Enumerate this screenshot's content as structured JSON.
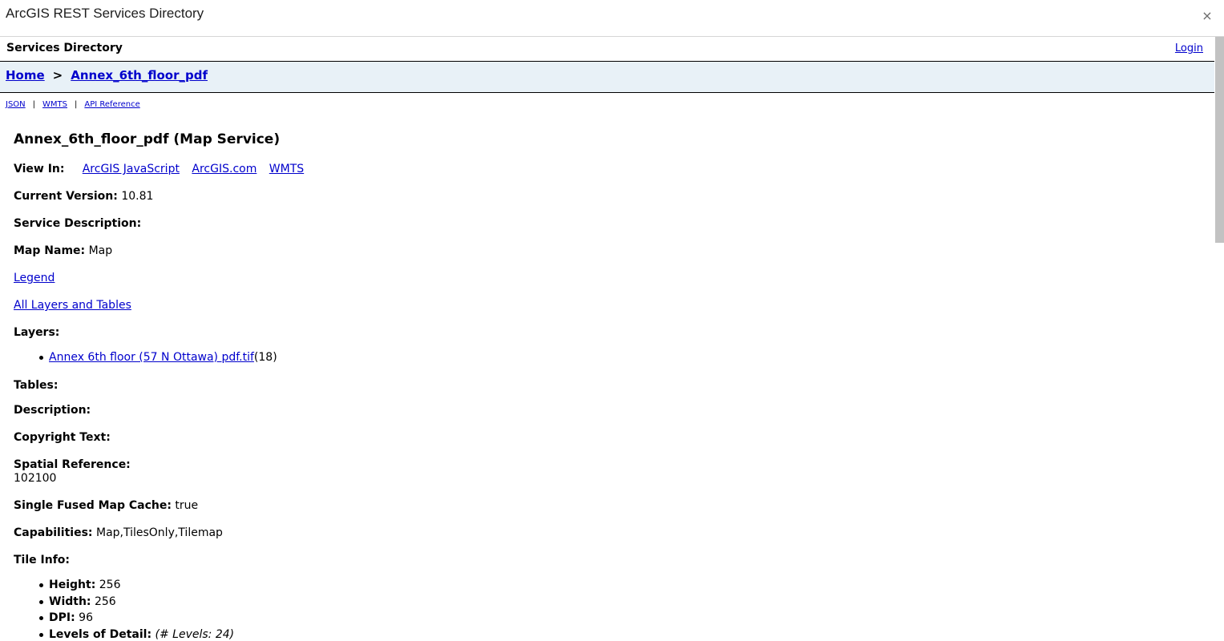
{
  "window": {
    "title": "ArcGIS REST Services Directory",
    "close_glyph": "×"
  },
  "header": {
    "label": "Services Directory",
    "login": "Login"
  },
  "breadcrumb": {
    "home": "Home",
    "separator": ">",
    "current": "Annex_6th_floor_pdf"
  },
  "formats": {
    "json": "JSON",
    "wmts": "WMTS",
    "api": "API Reference",
    "separator": "|"
  },
  "service": {
    "heading": "Annex_6th_floor_pdf (Map Service)",
    "view_in_label": "View In:",
    "view_in_links": [
      "ArcGIS JavaScript",
      "ArcGIS.com",
      "WMTS"
    ],
    "current_version_label": "Current Version:",
    "current_version": "10.81",
    "service_description_label": "Service Description:",
    "map_name_label": "Map Name:",
    "map_name": "Map",
    "legend_link": "Legend",
    "all_layers_link": "All Layers and Tables",
    "layers_label": "Layers:",
    "layers": [
      {
        "name": "Annex 6th floor (57 N Ottawa) pdf.tif",
        "id": "(18)"
      }
    ],
    "tables_label": "Tables:",
    "description_label": "Description:",
    "copyright_label": "Copyright Text:",
    "spatial_reference_label": "Spatial Reference:",
    "spatial_reference": "102100",
    "single_fused_label": "Single Fused Map Cache:",
    "single_fused": "true",
    "capabilities_label": "Capabilities:",
    "capabilities": "Map,TilesOnly,Tilemap",
    "tile_info_label": "Tile Info:",
    "tile_info": {
      "height_label": "Height:",
      "height": "256",
      "width_label": "Width:",
      "width": "256",
      "dpi_label": "DPI:",
      "dpi": "96",
      "lod_label": "Levels of Detail:",
      "lod": "(# Levels: 24)"
    }
  }
}
